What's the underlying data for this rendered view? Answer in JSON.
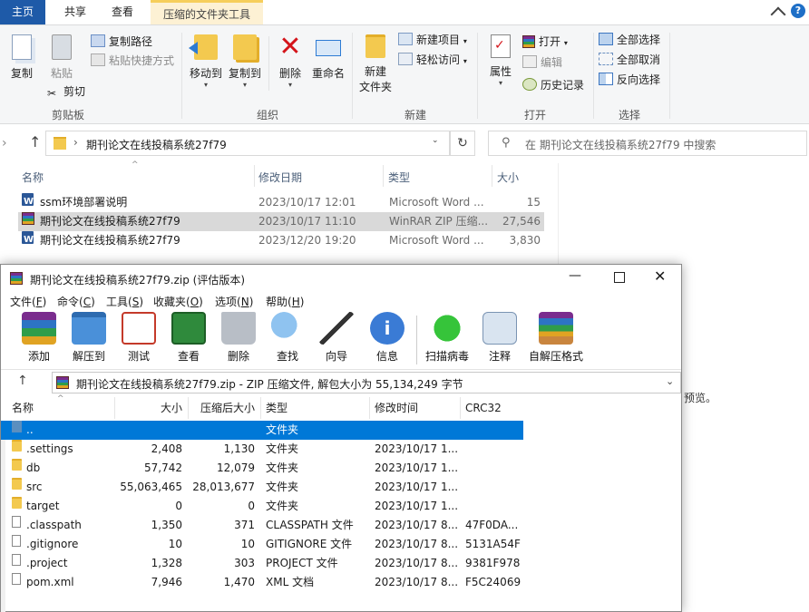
{
  "explorer": {
    "tabs": [
      "主页",
      "共享",
      "查看",
      "压缩的文件夹工具"
    ],
    "ribbon": {
      "clipboard": {
        "copy": "复制",
        "paste": "粘贴",
        "copy_path": "复制路径",
        "paste_shortcut": "粘贴快捷方式",
        "cut": "剪切",
        "label": "剪贴板"
      },
      "organize": {
        "move_to": "移动到",
        "copy_to": "复制到",
        "delete": "删除",
        "rename": "重命名",
        "label": "组织"
      },
      "new": {
        "new_folder_line1": "新建",
        "new_folder_line2": "文件夹",
        "new_item": "新建项目",
        "easy_access": "轻松访问",
        "label": "新建"
      },
      "open": {
        "properties": "属性",
        "open": "打开",
        "edit": "编辑",
        "history": "历史记录",
        "label": "打开"
      },
      "select": {
        "select_all": "全部选择",
        "select_none": "全部取消",
        "invert": "反向选择",
        "label": "选择"
      }
    },
    "address": {
      "path": "期刊论文在线投稿系统27f79",
      "search_placeholder": "在 期刊论文在线投稿系统27f79 中搜索"
    },
    "columns": {
      "name": "名称",
      "date": "修改日期",
      "type": "类型",
      "size": "大小"
    },
    "files": [
      {
        "name": "ssm环境部署说明",
        "date": "2023/10/17 12:01",
        "type": "Microsoft Word ...",
        "size": "15",
        "icon": "word-icon"
      },
      {
        "name": "期刊论文在线投稿系统27f79",
        "date": "2023/10/17 11:10",
        "type": "WinRAR ZIP 压缩...",
        "size": "27,546",
        "icon": "rar-icon"
      },
      {
        "name": "期刊论文在线投稿系统27f79",
        "date": "2023/12/20 19:20",
        "type": "Microsoft Word ...",
        "size": "3,830",
        "icon": "word-icon"
      }
    ],
    "right_fragment": "预览。"
  },
  "winrar": {
    "title": "期刊论文在线投稿系统27f79.zip (评估版本)",
    "menu": [
      {
        "label": "文件",
        "key": "F"
      },
      {
        "label": "命令",
        "key": "C"
      },
      {
        "label": "工具",
        "key": "S"
      },
      {
        "label": "收藏夹",
        "key": "O"
      },
      {
        "label": "选项",
        "key": "N"
      },
      {
        "label": "帮助",
        "key": "H"
      }
    ],
    "toolbar": [
      "添加",
      "解压到",
      "测试",
      "查看",
      "删除",
      "查找",
      "向导",
      "信息",
      "扫描病毒",
      "注释",
      "自解压格式"
    ],
    "path_bar": "期刊论文在线投稿系统27f79.zip - ZIP 压缩文件, 解包大小为 55,134,249 字节",
    "columns": {
      "name": "名称",
      "size": "大小",
      "packed": "压缩后大小",
      "type": "类型",
      "modified": "修改时间",
      "crc": "CRC32"
    },
    "rows": [
      {
        "name": "..",
        "size": "",
        "packed": "",
        "type": "文件夹",
        "modified": "",
        "crc": "",
        "kind": "up"
      },
      {
        "name": ".settings",
        "size": "2,408",
        "packed": "1,130",
        "type": "文件夹",
        "modified": "2023/10/17 1...",
        "crc": "",
        "kind": "folder"
      },
      {
        "name": "db",
        "size": "57,742",
        "packed": "12,079",
        "type": "文件夹",
        "modified": "2023/10/17 1...",
        "crc": "",
        "kind": "folder"
      },
      {
        "name": "src",
        "size": "55,063,465",
        "packed": "28,013,677",
        "type": "文件夹",
        "modified": "2023/10/17 1...",
        "crc": "",
        "kind": "folder"
      },
      {
        "name": "target",
        "size": "0",
        "packed": "0",
        "type": "文件夹",
        "modified": "2023/10/17 1...",
        "crc": "",
        "kind": "folder"
      },
      {
        "name": ".classpath",
        "size": "1,350",
        "packed": "371",
        "type": "CLASSPATH 文件",
        "modified": "2023/10/17 8...",
        "crc": "47F0DA...",
        "kind": "file"
      },
      {
        "name": ".gitignore",
        "size": "10",
        "packed": "10",
        "type": "GITIGNORE 文件",
        "modified": "2023/10/17 8...",
        "crc": "5131A54F",
        "kind": "file"
      },
      {
        "name": ".project",
        "size": "1,328",
        "packed": "303",
        "type": "PROJECT 文件",
        "modified": "2023/10/17 8...",
        "crc": "9381F978",
        "kind": "file"
      },
      {
        "name": "pom.xml",
        "size": "7,946",
        "packed": "1,470",
        "type": "XML 文档",
        "modified": "2023/10/17 8...",
        "crc": "F5C24069",
        "kind": "file"
      }
    ],
    "colors": {
      "selection": "#0078d7",
      "accent": "#1e58a8"
    }
  }
}
